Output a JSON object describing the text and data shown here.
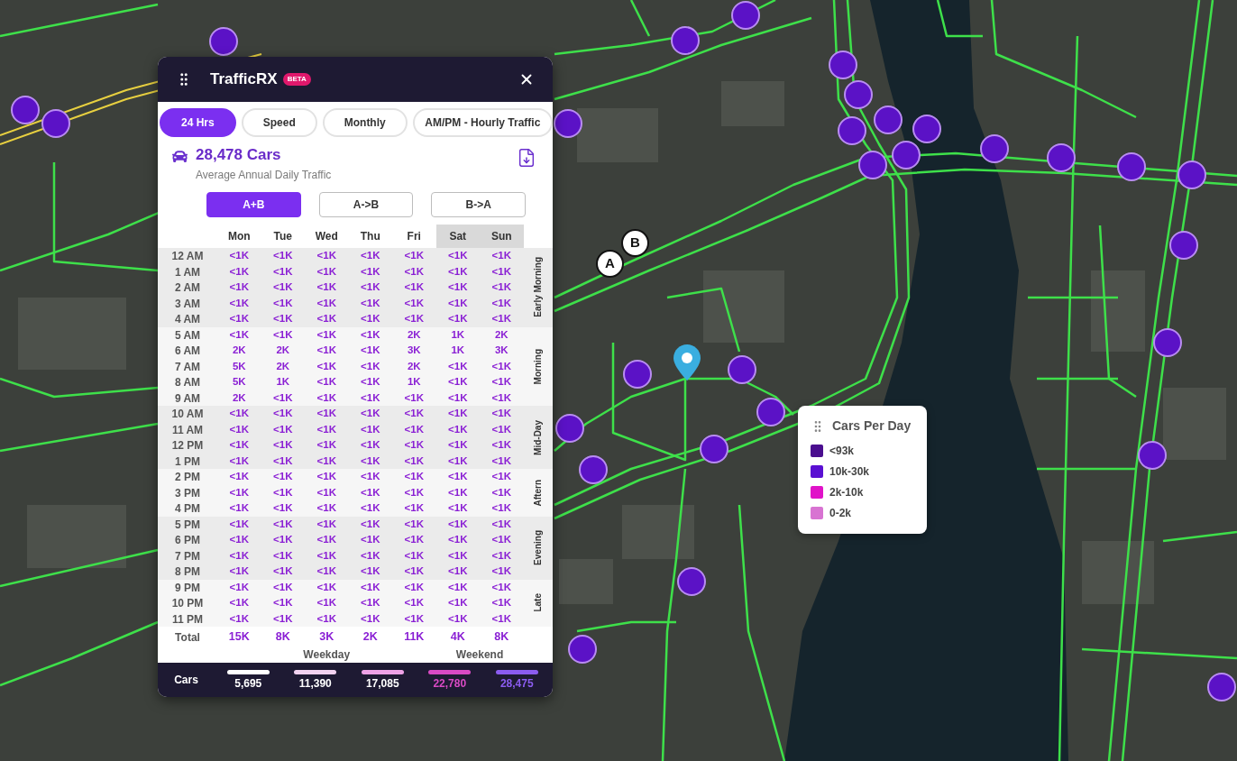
{
  "map": {
    "endpoints": [
      {
        "label": "B"
      },
      {
        "label": "A"
      }
    ]
  },
  "panel": {
    "title": "TrafficRX",
    "badge": "BETA",
    "tabs": [
      {
        "label": "24 Hrs",
        "selected": true
      },
      {
        "label": "Speed",
        "selected": false
      },
      {
        "label": "Monthly",
        "selected": false
      },
      {
        "label": "AM/PM - Hourly Traffic",
        "selected": false
      }
    ],
    "summary": {
      "value": "28,478 Cars",
      "caption": "Average Annual Daily Traffic"
    },
    "directions": [
      {
        "label": "A+B",
        "selected": true
      },
      {
        "label": "A->B",
        "selected": false
      },
      {
        "label": "B->A",
        "selected": false
      }
    ],
    "table": {
      "columns": [
        {
          "label": "Mon",
          "weekend": false
        },
        {
          "label": "Tue",
          "weekend": false
        },
        {
          "label": "Wed",
          "weekend": false
        },
        {
          "label": "Thu",
          "weekend": false
        },
        {
          "label": "Fri",
          "weekend": false
        },
        {
          "label": "Sat",
          "weekend": true
        },
        {
          "label": "Sun",
          "weekend": true
        }
      ],
      "periods": [
        {
          "label": "Early Morning",
          "rows": [
            {
              "hour": "12 AM",
              "values": [
                "<1K",
                "<1K",
                "<1K",
                "<1K",
                "<1K",
                "<1K",
                "<1K"
              ]
            },
            {
              "hour": "1 AM",
              "values": [
                "<1K",
                "<1K",
                "<1K",
                "<1K",
                "<1K",
                "<1K",
                "<1K"
              ]
            },
            {
              "hour": "2 AM",
              "values": [
                "<1K",
                "<1K",
                "<1K",
                "<1K",
                "<1K",
                "<1K",
                "<1K"
              ]
            },
            {
              "hour": "3 AM",
              "values": [
                "<1K",
                "<1K",
                "<1K",
                "<1K",
                "<1K",
                "<1K",
                "<1K"
              ]
            },
            {
              "hour": "4 AM",
              "values": [
                "<1K",
                "<1K",
                "<1K",
                "<1K",
                "<1K",
                "<1K",
                "<1K"
              ]
            }
          ]
        },
        {
          "label": "Morning",
          "rows": [
            {
              "hour": "5 AM",
              "values": [
                "<1K",
                "<1K",
                "<1K",
                "<1K",
                "2K",
                "1K",
                "2K"
              ]
            },
            {
              "hour": "6 AM",
              "values": [
                "2K",
                "2K",
                "<1K",
                "<1K",
                "3K",
                "1K",
                "3K"
              ]
            },
            {
              "hour": "7 AM",
              "values": [
                "5K",
                "2K",
                "<1K",
                "<1K",
                "2K",
                "<1K",
                "<1K"
              ]
            },
            {
              "hour": "8 AM",
              "values": [
                "5K",
                "1K",
                "<1K",
                "<1K",
                "1K",
                "<1K",
                "<1K"
              ]
            },
            {
              "hour": "9 AM",
              "values": [
                "2K",
                "<1K",
                "<1K",
                "<1K",
                "<1K",
                "<1K",
                "<1K"
              ]
            }
          ]
        },
        {
          "label": "Mid-Day",
          "rows": [
            {
              "hour": "10 AM",
              "values": [
                "<1K",
                "<1K",
                "<1K",
                "<1K",
                "<1K",
                "<1K",
                "<1K"
              ]
            },
            {
              "hour": "11 AM",
              "values": [
                "<1K",
                "<1K",
                "<1K",
                "<1K",
                "<1K",
                "<1K",
                "<1K"
              ]
            },
            {
              "hour": "12 PM",
              "values": [
                "<1K",
                "<1K",
                "<1K",
                "<1K",
                "<1K",
                "<1K",
                "<1K"
              ]
            },
            {
              "hour": "1 PM",
              "values": [
                "<1K",
                "<1K",
                "<1K",
                "<1K",
                "<1K",
                "<1K",
                "<1K"
              ]
            }
          ]
        },
        {
          "label": "Aftern",
          "rows": [
            {
              "hour": "2 PM",
              "values": [
                "<1K",
                "<1K",
                "<1K",
                "<1K",
                "<1K",
                "<1K",
                "<1K"
              ]
            },
            {
              "hour": "3 PM",
              "values": [
                "<1K",
                "<1K",
                "<1K",
                "<1K",
                "<1K",
                "<1K",
                "<1K"
              ]
            },
            {
              "hour": "4 PM",
              "values": [
                "<1K",
                "<1K",
                "<1K",
                "<1K",
                "<1K",
                "<1K",
                "<1K"
              ]
            }
          ]
        },
        {
          "label": "Evening",
          "rows": [
            {
              "hour": "5 PM",
              "values": [
                "<1K",
                "<1K",
                "<1K",
                "<1K",
                "<1K",
                "<1K",
                "<1K"
              ]
            },
            {
              "hour": "6 PM",
              "values": [
                "<1K",
                "<1K",
                "<1K",
                "<1K",
                "<1K",
                "<1K",
                "<1K"
              ]
            },
            {
              "hour": "7 PM",
              "values": [
                "<1K",
                "<1K",
                "<1K",
                "<1K",
                "<1K",
                "<1K",
                "<1K"
              ]
            },
            {
              "hour": "8 PM",
              "values": [
                "<1K",
                "<1K",
                "<1K",
                "<1K",
                "<1K",
                "<1K",
                "<1K"
              ]
            }
          ]
        },
        {
          "label": "Late",
          "rows": [
            {
              "hour": "9 PM",
              "values": [
                "<1K",
                "<1K",
                "<1K",
                "<1K",
                "<1K",
                "<1K",
                "<1K"
              ]
            },
            {
              "hour": "10 PM",
              "values": [
                "<1K",
                "<1K",
                "<1K",
                "<1K",
                "<1K",
                "<1K",
                "<1K"
              ]
            },
            {
              "hour": "11 PM",
              "values": [
                "<1K",
                "<1K",
                "<1K",
                "<1K",
                "<1K",
                "<1K",
                "<1K"
              ]
            }
          ]
        }
      ],
      "total": {
        "label": "Total",
        "values": [
          "15K",
          "8K",
          "3K",
          "2K",
          "11K",
          "4K",
          "8K"
        ]
      },
      "groups": [
        {
          "label": "Weekday"
        },
        {
          "label": "Weekend"
        }
      ]
    },
    "scale": {
      "label": "Cars",
      "steps": [
        {
          "value": "5,695",
          "color": "#ffffff"
        },
        {
          "value": "11,390",
          "color": "#f2d2f0"
        },
        {
          "value": "17,085",
          "color": "#eea2e6"
        },
        {
          "value": "22,780",
          "color": "#d94ac4"
        },
        {
          "value": "28,475",
          "color": "#8b5cf0"
        }
      ]
    }
  },
  "legend": {
    "title": "Cars Per Day",
    "items": [
      {
        "label": "<93k",
        "color": "#4a0e8f"
      },
      {
        "label": "10k-30k",
        "color": "#5a10d2"
      },
      {
        "label": "2k-10k",
        "color": "#e012c8"
      },
      {
        "label": "0-2k",
        "color": "#d873d2"
      }
    ]
  }
}
